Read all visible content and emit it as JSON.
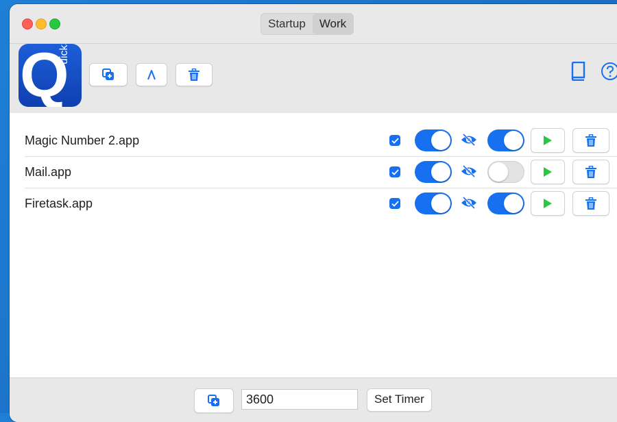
{
  "window": {
    "segments": [
      {
        "label": "Startup",
        "selected": false
      },
      {
        "label": "Work",
        "selected": true
      }
    ]
  },
  "toolbar": {
    "logo": {
      "letter": "Q",
      "side_text": "uickStart"
    },
    "buttons": [
      "duplicate-add-icon",
      "pencil-tip-icon",
      "trash-icon"
    ],
    "right_icons": [
      "book-icon",
      "help-icon"
    ]
  },
  "apps": [
    {
      "name": "Magic Number 2.app",
      "checked": true,
      "toggle1": true,
      "hidden_icon": "eye-slash-icon",
      "toggle2": true
    },
    {
      "name": "Mail.app",
      "checked": true,
      "toggle1": true,
      "hidden_icon": "eye-slash-icon",
      "toggle2": false
    },
    {
      "name": "Firetask.app",
      "checked": true,
      "toggle1": true,
      "hidden_icon": "eye-slash-icon",
      "toggle2": true
    }
  ],
  "bottom": {
    "timer_value": "3600",
    "set_timer_label": "Set Timer"
  },
  "colors": {
    "accent": "#1670f0",
    "play": "#28c840",
    "desktop": "#1e7fd6"
  }
}
